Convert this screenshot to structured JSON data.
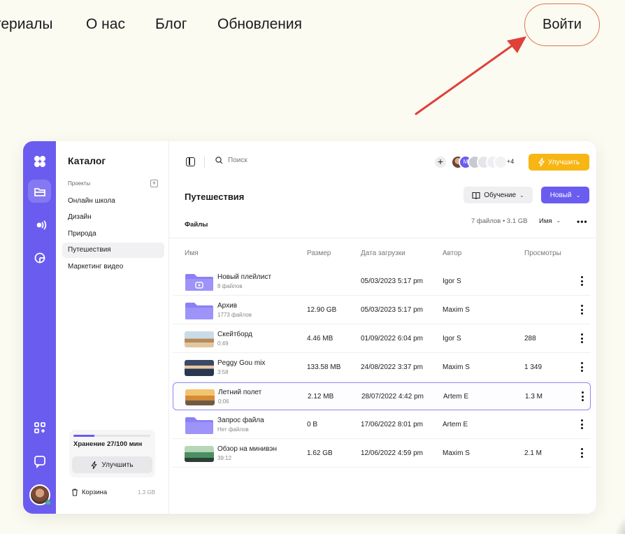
{
  "nav": {
    "links": [
      "териалы",
      "О нас",
      "Блог",
      "Обновления"
    ],
    "login": "Войти"
  },
  "colors": {
    "accent": "#6b5cf0",
    "upgrade": "#f7b614",
    "login_border": "#e0764d",
    "arrow": "#e0403a"
  },
  "rail_icons": [
    "logo-icon",
    "folder-icon",
    "broadcast-icon",
    "pie-icon",
    "apps-icon",
    "chat-icon"
  ],
  "sidebar": {
    "title": "Каталог",
    "section": "Проекты",
    "items": [
      "Онлайн школа",
      "Дизайн",
      "Природа",
      "Путешествия",
      "Маркетинг видео"
    ],
    "storage": {
      "text": "Хранение 27/100 мин",
      "used_fraction": 0.27,
      "button": "Улучшить"
    },
    "trash": {
      "label": "Корзина",
      "size": "1.3 GB"
    }
  },
  "toolbar": {
    "search_placeholder": "Поиск",
    "collab_more": "+4",
    "upgrade": "Улучшить",
    "avatar_letter": "M"
  },
  "page": {
    "title": "Путешествия",
    "learn_button": "Обучение",
    "new_button": "Новый",
    "files_label": "Файлы",
    "files_count": "7 файлов • 3.1 GB",
    "sort_label": "Имя"
  },
  "table": {
    "headers": [
      "Имя",
      "Размер",
      "Дата загрузки",
      "Автор",
      "Просмотры"
    ],
    "rows": [
      {
        "name": "Новый плейлист",
        "sub": "8 файлов",
        "size": "",
        "date": "05/03/2023 5:17 pm",
        "author": "Igor S",
        "views": "",
        "kind": "playlist-folder"
      },
      {
        "name": "Архив",
        "sub": "1773 файлов",
        "size": "12.90 GB",
        "date": "05/03/2023 5:17 pm",
        "author": "Maxim S",
        "views": "",
        "kind": "folder"
      },
      {
        "name": "Скейтборд",
        "sub": "0:49",
        "size": "4.46 MB",
        "date": "01/09/2022 6:04 pm",
        "author": "Igor S",
        "views": "288",
        "kind": "video"
      },
      {
        "name": "Peggy Gou mix",
        "sub": "3:58",
        "size": "133.58 MB",
        "date": "24/08/2022 3:37 pm",
        "author": "Maxim S",
        "views": "1 349",
        "kind": "video"
      },
      {
        "name": "Летний полет",
        "sub": "0:06",
        "size": "2.12 MB",
        "date": "28/07/2022 4:42 pm",
        "author": "Artem E",
        "views": "1.3 M",
        "kind": "video"
      },
      {
        "name": "Запрос файла",
        "sub": "Нет файлов",
        "size": "0 B",
        "date": "17/06/2022 8:01 pm",
        "author": "Artem E",
        "views": "",
        "kind": "folder"
      },
      {
        "name": "Обзор на минивэн",
        "sub": "39:12",
        "size": "1.62 GB",
        "date": "12/06/2022 4:59 pm",
        "author": "Maxim S",
        "views": "2.1 M",
        "kind": "video"
      }
    ],
    "selected_index": 4
  }
}
